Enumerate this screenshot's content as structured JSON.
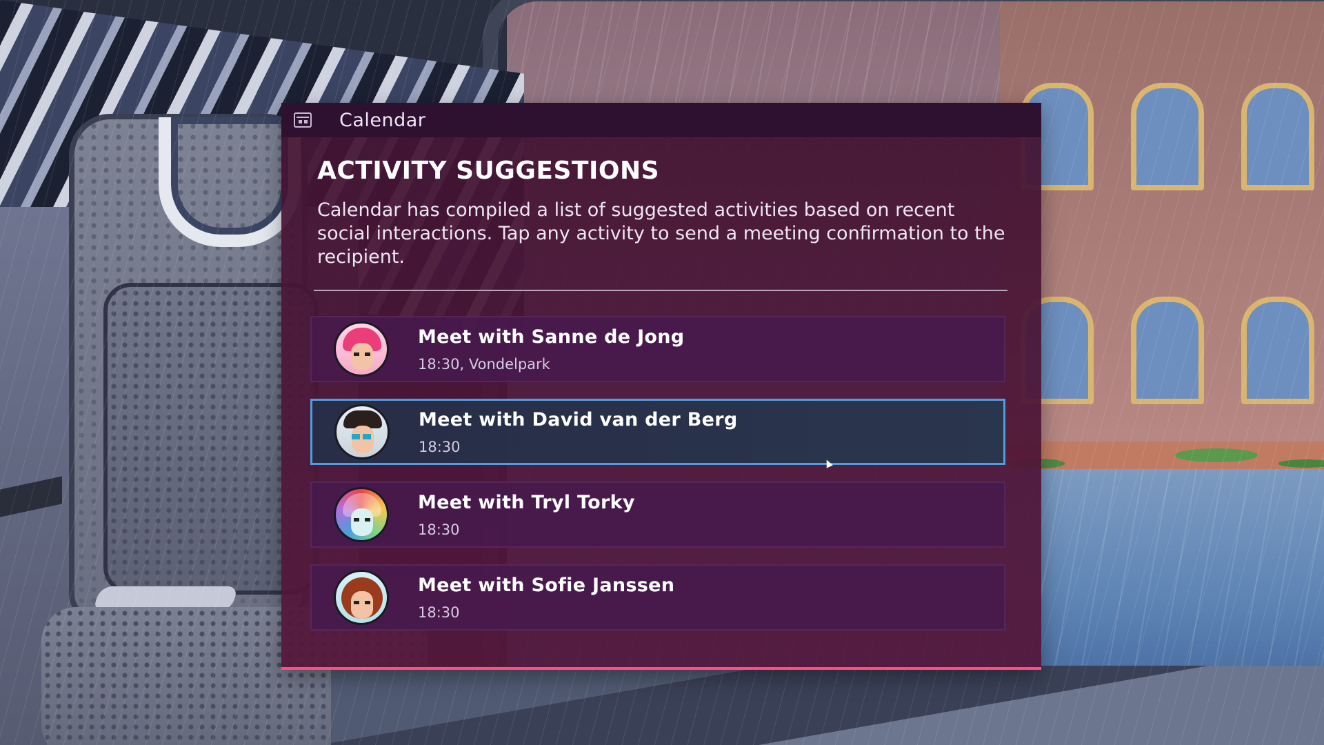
{
  "window": {
    "title": "Calendar",
    "icon": "calendar-icon"
  },
  "panel": {
    "heading": "ACTIVITY SUGGESTIONS",
    "description": "Calendar has compiled a list of suggested activities based on recent social interactions. Tap any activity to send a meeting confirmation to the recipient."
  },
  "activities": [
    {
      "title": "Meet with Sanne de Jong",
      "detail": "18:30, Vondelpark",
      "selected": false
    },
    {
      "title": "Meet with David van der Berg",
      "detail": "18:30",
      "selected": true
    },
    {
      "title": "Meet with Tryl Torky",
      "detail": "18:30",
      "selected": false
    },
    {
      "title": "Meet with Sofie Janssen",
      "detail": "18:30",
      "selected": false
    }
  ],
  "colors": {
    "panel_bg": "#4a1638",
    "titlebar_bg": "#2d1030",
    "selected_border": "#4f9fe0",
    "accent_bottom": "#ff4f7f"
  }
}
